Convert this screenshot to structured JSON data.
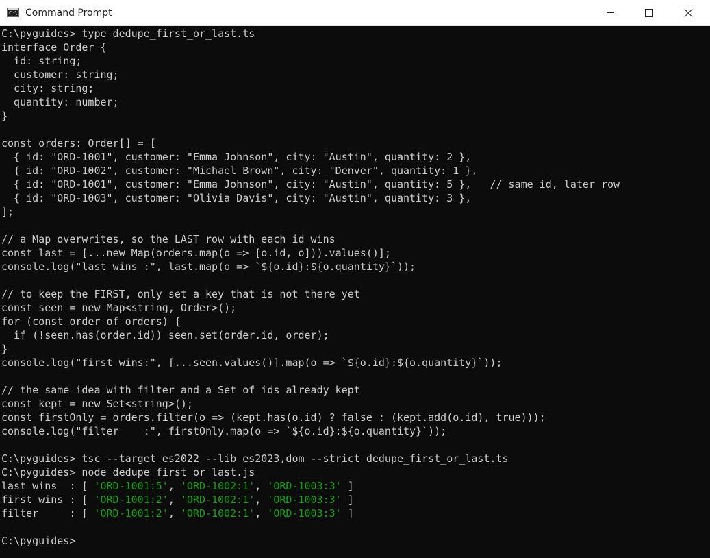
{
  "window": {
    "title": "Command Prompt",
    "icon": "cmd-icon",
    "icon_text": "C:\\",
    "buttons": [
      "minimize-icon",
      "maximize-icon",
      "close-icon"
    ]
  },
  "colors": {
    "background": "#0c0c0c",
    "text": "#cccccc",
    "string_output": "#13a10e"
  },
  "console": {
    "source_lines": [
      "C:\\pyguides> type dedupe_first_or_last.ts",
      "interface Order {",
      "  id: string;",
      "  customer: string;",
      "  city: string;",
      "  quantity: number;",
      "}",
      "",
      "const orders: Order[] = [",
      "  { id: \"ORD-1001\", customer: \"Emma Johnson\", city: \"Austin\", quantity: 2 },",
      "  { id: \"ORD-1002\", customer: \"Michael Brown\", city: \"Denver\", quantity: 1 },",
      "  { id: \"ORD-1001\", customer: \"Emma Johnson\", city: \"Austin\", quantity: 5 },   // same id, later row",
      "  { id: \"ORD-1003\", customer: \"Olivia Davis\", city: \"Austin\", quantity: 3 },",
      "];",
      "",
      "// a Map overwrites, so the LAST row with each id wins",
      "const last = [...new Map(orders.map(o => [o.id, o])).values()];",
      "console.log(\"last wins :\", last.map(o => `${o.id}:${o.quantity}`));",
      "",
      "// to keep the FIRST, only set a key that is not there yet",
      "const seen = new Map<string, Order>();",
      "for (const order of orders) {",
      "  if (!seen.has(order.id)) seen.set(order.id, order);",
      "}",
      "console.log(\"first wins:\", [...seen.values()].map(o => `${o.id}:${o.quantity}`));",
      "",
      "// the same idea with filter and a Set of ids already kept",
      "const kept = new Set<string>();",
      "const firstOnly = orders.filter(o => (kept.has(o.id) ? false : (kept.add(o.id), true)));",
      "console.log(\"filter    :\", firstOnly.map(o => `${o.id}:${o.quantity}`));",
      "",
      "C:\\pyguides> tsc --target es2022 --lib es2023,dom --strict dedupe_first_or_last.ts",
      "C:\\pyguides> node dedupe_first_or_last.js"
    ],
    "results": [
      {
        "label": "last wins",
        "values": [
          "'ORD-1001:5'",
          "'ORD-1002:1'",
          "'ORD-1003:3'"
        ]
      },
      {
        "label": "first wins",
        "values": [
          "'ORD-1001:2'",
          "'ORD-1002:1'",
          "'ORD-1003:3'"
        ]
      },
      {
        "label": "filter",
        "values": [
          "'ORD-1001:2'",
          "'ORD-1002:1'",
          "'ORD-1003:3'"
        ]
      }
    ],
    "final_prompt": "C:\\pyguides>"
  }
}
